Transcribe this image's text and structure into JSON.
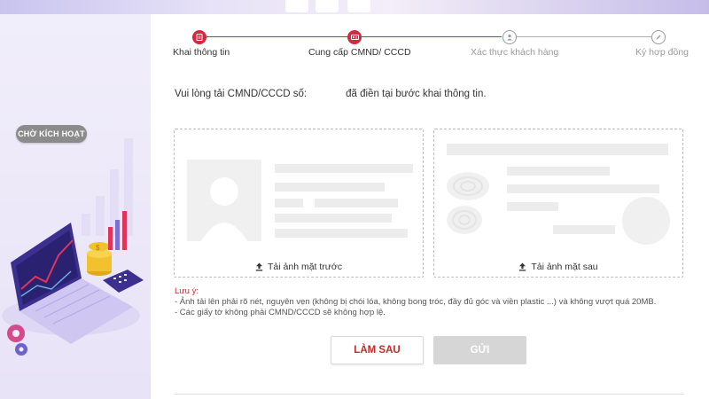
{
  "status_badge": "CHỜ KÍCH HOẠT",
  "colors": {
    "accent": "#d7263d",
    "inactive": "#9a9a9a",
    "note_red": "#c62828"
  },
  "stepper": {
    "steps": [
      {
        "label": "Khai thông tin",
        "icon": "form-icon",
        "state": "done"
      },
      {
        "label": "Cung cấp CMND/ CCCD",
        "icon": "id-card-icon",
        "state": "current"
      },
      {
        "label": "Xác thực khách hàng",
        "icon": "user-icon",
        "state": "pending"
      },
      {
        "label": "Ký hợp đồng",
        "icon": "pen-icon",
        "state": "pending"
      }
    ]
  },
  "instruction": {
    "prefix": "Vui lòng tải CMND/CCCD số:",
    "suffix": "đã điền tại bước khai thông tin."
  },
  "uploads": {
    "front_label": "Tải ảnh mặt trước",
    "back_label": "Tải ảnh mặt sau",
    "icon": "upload-icon"
  },
  "notes": {
    "title": "Lưu ý:",
    "lines": [
      "- Ảnh tải lên phải rõ nét, nguyên vẹn (không bị chói lóa, không bong tróc, đầy đủ góc và viền plastic ...) và không vượt quá 20MB.",
      "- Các giấy tờ không phải CMND/CCCD sẽ không hợp lệ."
    ]
  },
  "buttons": {
    "later": "LÀM SAU",
    "send": "GỬI"
  }
}
